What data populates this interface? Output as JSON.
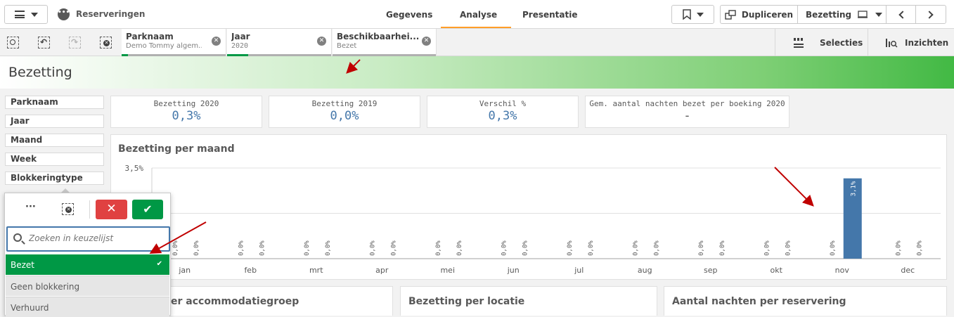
{
  "toolbar": {
    "app_title": "Reserveringen",
    "tabs": [
      "Gegevens",
      "Analyse",
      "Presentatie"
    ],
    "duplicate_label": "Dupliceren",
    "sheet_label": "Bezetting"
  },
  "selections": {
    "chips": [
      {
        "title": "Parknaam",
        "value": "Demo Tommy algem...",
        "fill": 0.06
      },
      {
        "title": "Jaar",
        "value": "2020",
        "fill": 0.2
      },
      {
        "title": "Beschikbaarhei...",
        "value": "Bezet",
        "fill": 0
      }
    ],
    "selections_label": "Selecties",
    "insights_label": "Inzichten"
  },
  "sheet": {
    "title": "Bezetting"
  },
  "filters": [
    "Parknaam",
    "Jaar",
    "Maand",
    "Week",
    "Blokkeringtype"
  ],
  "kpis": [
    {
      "label": "Bezetting 2020",
      "value": "0,3%"
    },
    {
      "label": "Bezetting 2019",
      "value": "0,0%"
    },
    {
      "label": "Verschil %",
      "value": "0,3%"
    },
    {
      "label": "Gem. aantal nachten bezet per boeking 2020",
      "value": "-"
    }
  ],
  "chart_data": {
    "type": "bar",
    "title": "Bezetting per maand",
    "categories": [
      "jan",
      "feb",
      "mrt",
      "apr",
      "mei",
      "jun",
      "jul",
      "aug",
      "sep",
      "okt",
      "nov",
      "dec"
    ],
    "series": [
      {
        "values": [
          0.0,
          0.0,
          0.0,
          0.0,
          0.0,
          0.0,
          0.0,
          0.0,
          0.0,
          0.0,
          0.0,
          0.0
        ]
      },
      {
        "values": [
          0.0,
          0.0,
          0.0,
          0.0,
          0.0,
          0.0,
          0.0,
          0.0,
          0.0,
          0.0,
          3.1,
          0.0
        ]
      }
    ],
    "data_labels": [
      "0,0%",
      "0,0%",
      "0,0%",
      "0,0%",
      "0,0%",
      "0,0%",
      "0,0%",
      "0,0%",
      "0,0%",
      "0,0%",
      "0,0%",
      "0,0%",
      "0,0%",
      "0,0%",
      "0,0%",
      "0,0%",
      "0,0%",
      "0,0%",
      "0,0%",
      "0,0%",
      "0,0%",
      "3,1%",
      "0,0%",
      "0,0%"
    ],
    "ytick": "3,5%",
    "ylim": [
      0,
      3.5
    ],
    "color": "#4477aa"
  },
  "bottom_cards": [
    "er accommodatiegroep",
    "Bezetting per locatie",
    "Aantal nachten per reservering"
  ],
  "listbox": {
    "placeholder": "Zoeken in keuzelijst",
    "items": [
      "Bezet",
      "Geen blokkering",
      "Verhuurd"
    ],
    "selected_color": "#009845",
    "cancel_color": "#e04141"
  }
}
